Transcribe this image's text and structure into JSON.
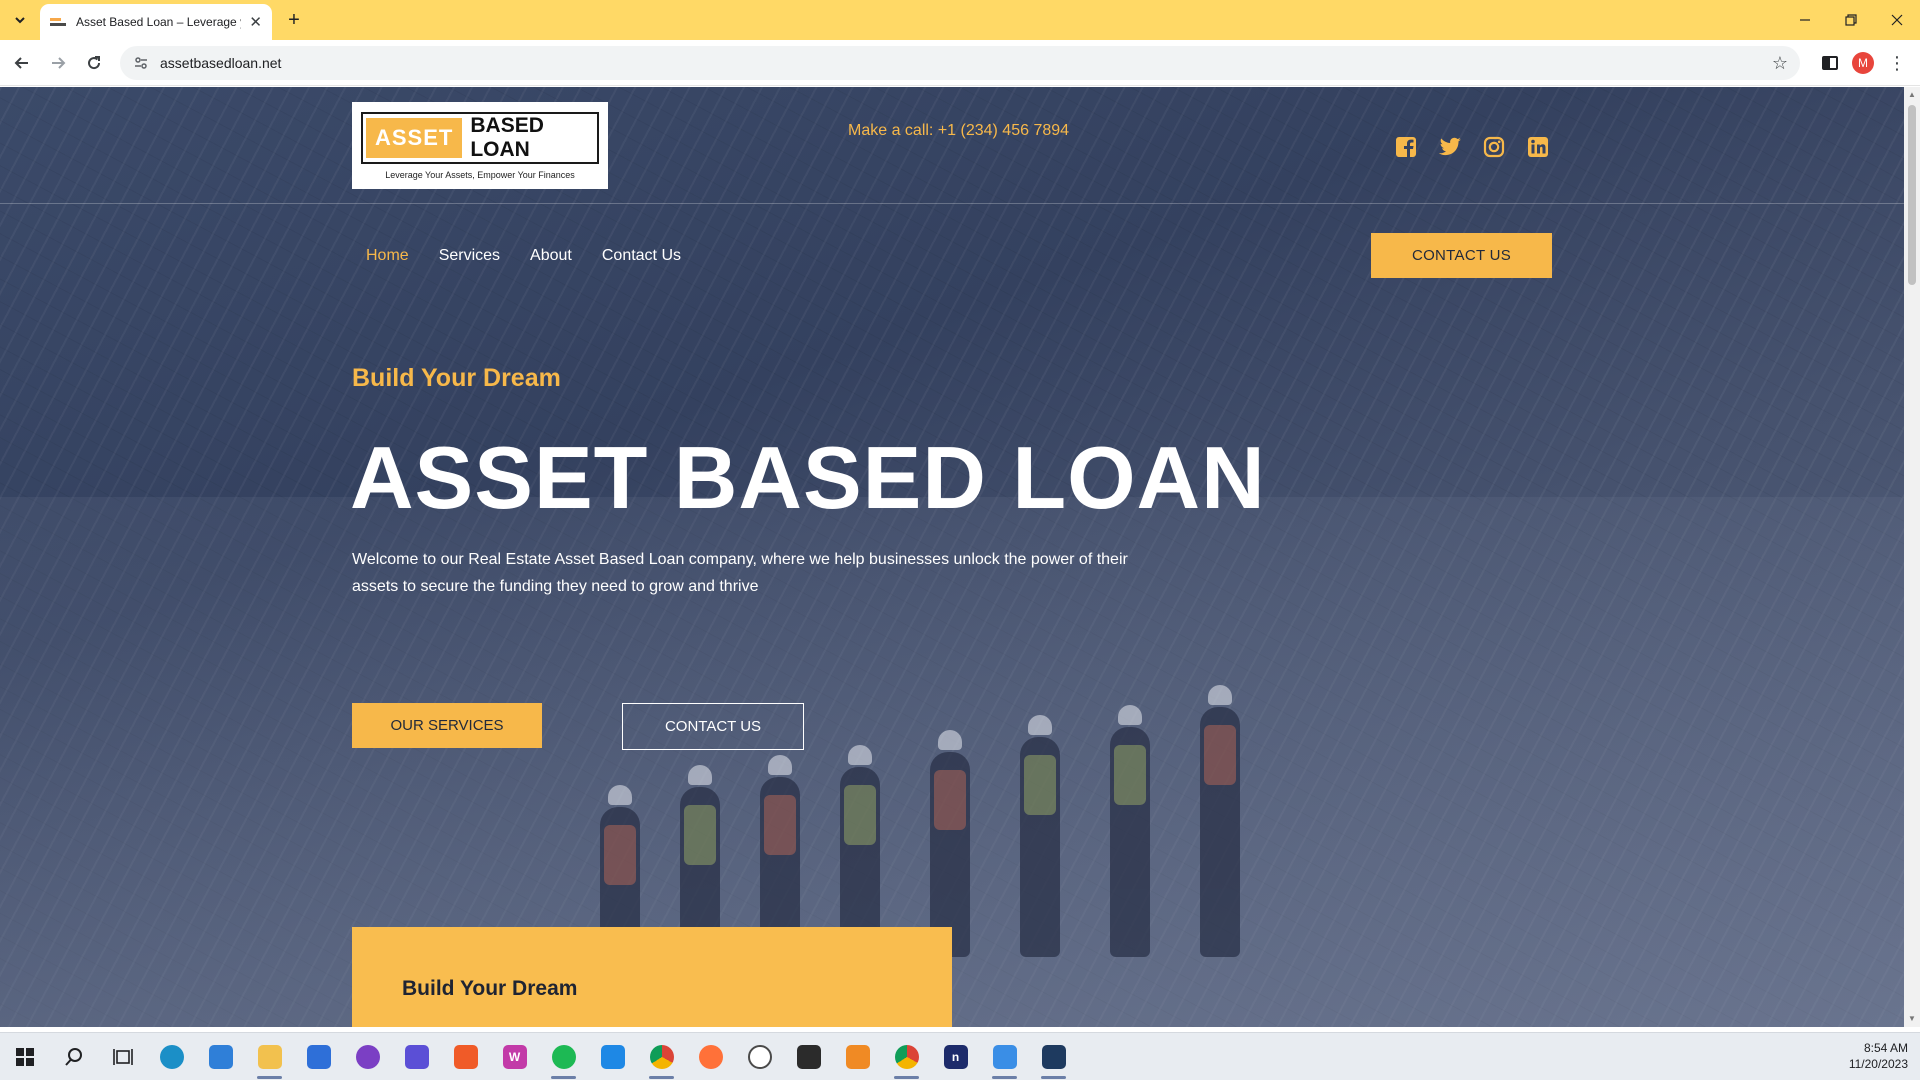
{
  "browser": {
    "tab_title": "Asset Based Loan – Leverage your Assets",
    "url": "assetbasedloan.net",
    "profile_initial": "M"
  },
  "header": {
    "logo_word_1": "ASSET",
    "logo_word_2": "BASED LOAN",
    "logo_tagline": "Leverage Your Assets, Empower Your Finances",
    "call_text": "Make a call: +1 (234) 456 7894",
    "socials": [
      "facebook-icon",
      "twitter-icon",
      "instagram-icon",
      "linkedin-icon"
    ]
  },
  "nav": {
    "items": [
      {
        "label": "Home",
        "active": true
      },
      {
        "label": "Services",
        "active": false
      },
      {
        "label": "About",
        "active": false
      },
      {
        "label": "Contact Us",
        "active": false
      }
    ],
    "cta_label": "CONTACT US"
  },
  "hero": {
    "kicker": "Build Your Dream",
    "headline": "ASSET BASED LOAN",
    "intro": "Welcome to our Real Estate  Asset Based Loan company, where we help businesses unlock the power of their assets to secure the funding they need to grow and thrive",
    "primary_button": "OUR SERVICES",
    "secondary_button": "CONTACT US"
  },
  "card": {
    "kicker": "Build Your Dream"
  },
  "taskbar": {
    "time": "8:54 AM",
    "date": "11/20/2023"
  },
  "colors": {
    "accent": "#f7b84a",
    "hero_overlay": "#34415f",
    "tab_strip": "#ffd966"
  }
}
